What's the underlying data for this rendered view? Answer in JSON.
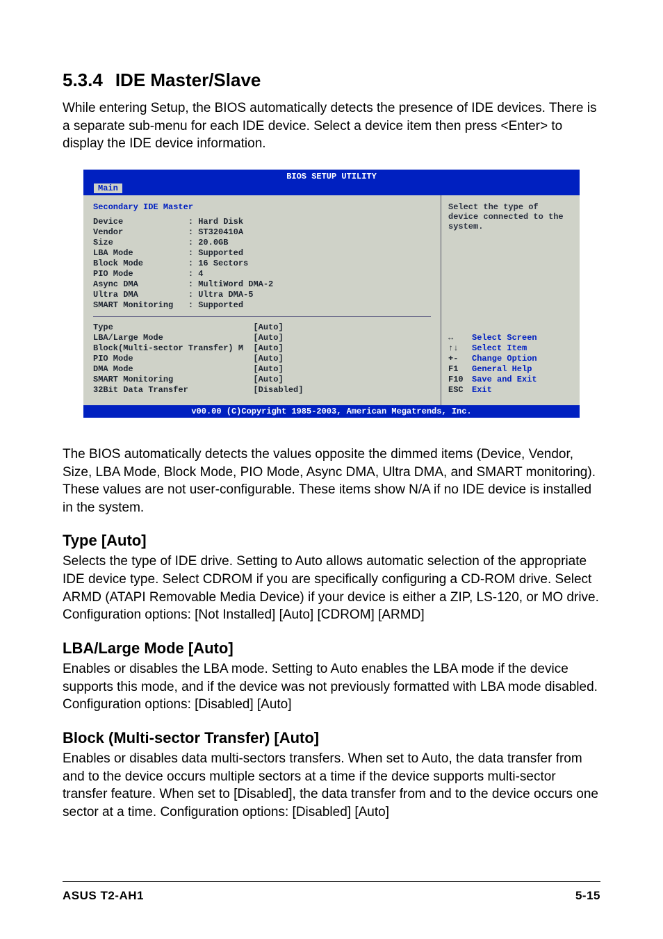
{
  "section": {
    "number": "5.3.4",
    "title": "IDE Master/Slave"
  },
  "intro": "While entering Setup, the BIOS automatically detects the presence of IDE devices. There is a separate sub-menu for each IDE device. Select a device item then press <Enter> to display the IDE device information.",
  "bios": {
    "title": "BIOS SETUP UTILITY",
    "tab": "Main",
    "heading": "Secondary IDE Master",
    "info_rows": [
      {
        "k": "Device",
        "v": ": Hard Disk"
      },
      {
        "k": "Vendor",
        "v": ": ST320410A"
      },
      {
        "k": "Size",
        "v": ": 20.0GB"
      },
      {
        "k": "LBA Mode",
        "v": ": Supported"
      },
      {
        "k": "Block Mode",
        "v": ": 16 Sectors"
      },
      {
        "k": "PIO Mode",
        "v": ": 4"
      },
      {
        "k": "Async DMA",
        "v": ": MultiWord DMA-2"
      },
      {
        "k": "Ultra DMA",
        "v": ": Ultra DMA-5"
      },
      {
        "k": "SMART Monitoring",
        "v": ": Supported"
      }
    ],
    "setting_rows": [
      {
        "k": "Type",
        "v": "[Auto]"
      },
      {
        "k": "LBA/Large Mode",
        "v": "[Auto]"
      },
      {
        "k": "Block(Multi-sector Transfer) M",
        "v": "[Auto]"
      },
      {
        "k": "PIO Mode",
        "v": "[Auto]"
      },
      {
        "k": "DMA Mode",
        "v": "[Auto]"
      },
      {
        "k": "SMART Monitoring",
        "v": "[Auto]"
      },
      {
        "k": "32Bit Data Transfer",
        "v": "[Disabled]"
      }
    ],
    "hint": "Select the type of device connected to the system.",
    "keys": [
      {
        "k": "↔",
        "l": "Select Screen"
      },
      {
        "k": "↑↓",
        "l": "Select Item"
      },
      {
        "k": "+-",
        "l": "Change Option"
      },
      {
        "k": "F1",
        "l": "General Help"
      },
      {
        "k": "F10",
        "l": "Save and Exit"
      },
      {
        "k": "ESC",
        "l": "Exit"
      }
    ],
    "footer": "v00.00 (C)Copyright 1985-2003, American Megatrends, Inc."
  },
  "after_bios": "The BIOS automatically detects the values opposite the dimmed items (Device, Vendor, Size, LBA Mode, Block Mode, PIO Mode, Async DMA, Ultra DMA, and SMART monitoring). These values are not user-configurable. These items show N/A if no IDE device is installed in the system.",
  "sub1": {
    "title": "Type [Auto]",
    "body": "Selects the type of IDE drive. Setting to Auto allows automatic selection of the appropriate IDE device type. Select CDROM if you are specifically configuring a CD-ROM drive. Select ARMD (ATAPI Removable Media Device) if your device is either a ZIP, LS-120, or MO drive.\nConfiguration options: [Not Installed] [Auto] [CDROM] [ARMD]"
  },
  "sub2": {
    "title": "LBA/Large Mode [Auto]",
    "body": "Enables or disables the LBA mode. Setting to Auto enables the LBA mode if the device supports this mode, and if the device was not previously formatted with LBA mode disabled. Configuration options: [Disabled] [Auto]"
  },
  "sub3": {
    "title": "Block (Multi-sector Transfer) [Auto]",
    "body": "Enables or disables data multi-sectors transfers. When set to Auto, the data transfer from and to the device occurs multiple sectors at a time if the device supports multi-sector transfer feature. When set to [Disabled], the data transfer from and to the device occurs one sector at a time. Configuration options: [Disabled] [Auto]"
  },
  "footer": {
    "left": "ASUS T2-AH1",
    "right": "5-15"
  }
}
